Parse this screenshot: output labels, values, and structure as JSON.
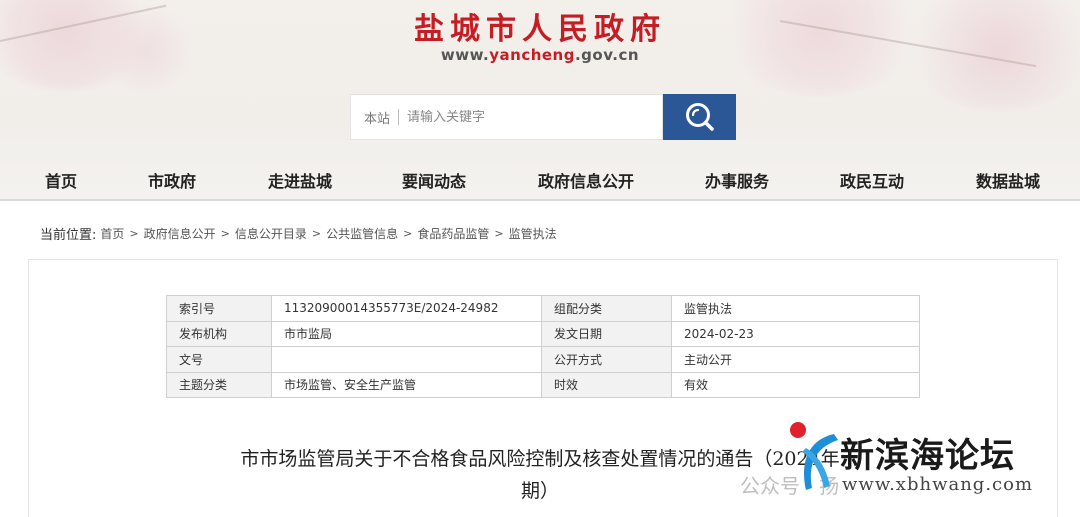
{
  "header": {
    "site_title": "盐城市人民政府",
    "url_prefix": "www.",
    "url_highlight": "yancheng",
    "url_suffix": ".gov.cn"
  },
  "search": {
    "scope": "本站",
    "placeholder": "请输入关键字",
    "button_icon": "search-icon"
  },
  "nav": {
    "items": [
      "首页",
      "市政府",
      "走进盐城",
      "要闻动态",
      "政府信息公开",
      "办事服务",
      "政民互动",
      "数据盐城"
    ]
  },
  "breadcrumb": {
    "lead": "当前位置:",
    "items": [
      "首页",
      "政府信息公开",
      "信息公开目录",
      "公共监管信息",
      "食品药品监管",
      "监管执法"
    ]
  },
  "meta_table": {
    "rows": [
      {
        "k1": "索引号",
        "v1": "11320900014355773E/2024-24982",
        "k2": "组配分类",
        "v2": "监管执法"
      },
      {
        "k1": "发布机构",
        "v1": "市市监局",
        "k2": "发文日期",
        "v2": "2024-02-23"
      },
      {
        "k1": "文号",
        "v1": "",
        "k2": "公开方式",
        "v2": "主动公开"
      },
      {
        "k1": "主题分类",
        "v1": "市场监管、安全生产监管",
        "k2": "时效",
        "v2": "有效"
      }
    ]
  },
  "article": {
    "title_line1": "市市场监管局关于不合格食品风险控制及核查处置情况的通告（2024年",
    "title_line2": "期）"
  },
  "watermark": {
    "brand": "新滨海论坛",
    "url": "www.xbhwang.com",
    "official_account": "公众号 · 扬"
  },
  "colors": {
    "brand_red": "#c41d23",
    "search_button": "#2b5796"
  }
}
